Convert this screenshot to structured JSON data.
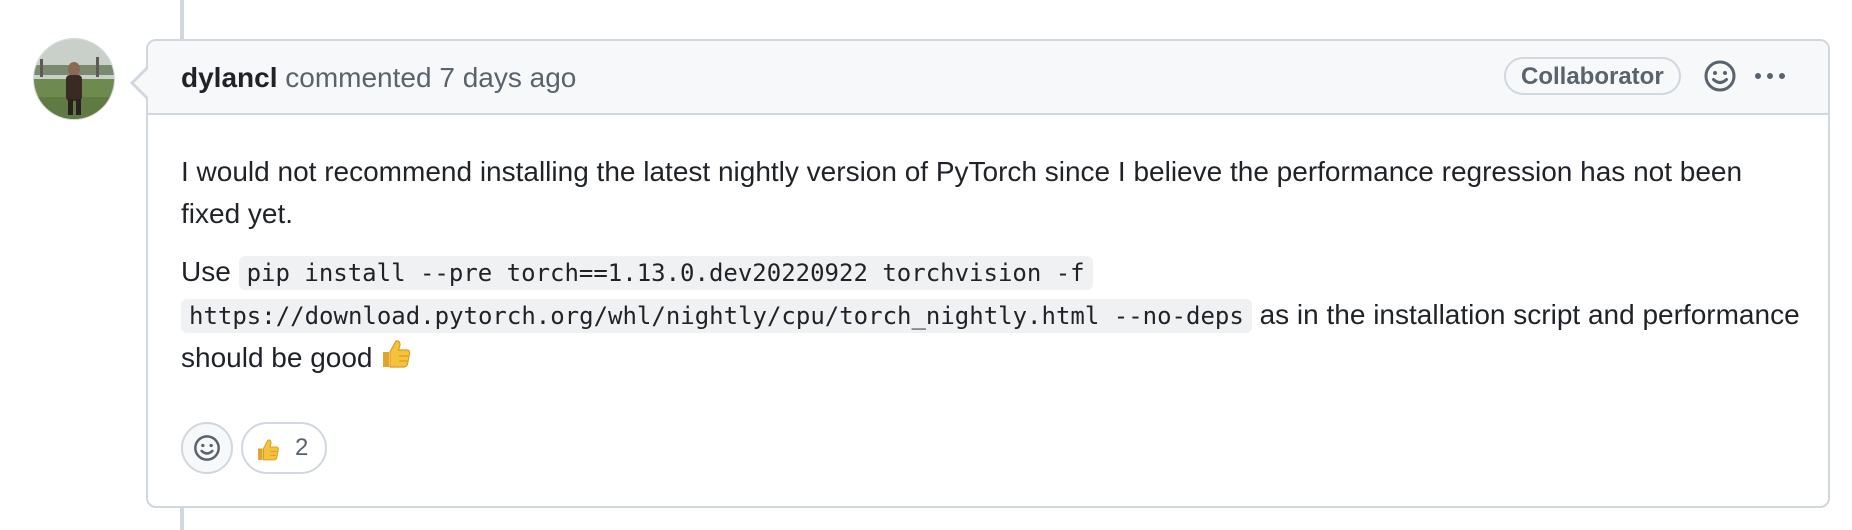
{
  "comment": {
    "author": "dylancl",
    "action": "commented",
    "time": "7 days ago",
    "role_badge": "Collaborator",
    "body": {
      "paragraph1": "I would not recommend installing the latest nightly version of PyTorch since I believe the performance regression has not been fixed yet.",
      "paragraph2_prefix": "Use",
      "code_line1": "pip install --pre torch==1.13.0.dev20220922 torchvision -f",
      "code_line2": "https://download.pytorch.org/whl/nightly/cpu/torch_nightly.html --no-deps",
      "paragraph2_suffix": "as in the installation script and performance should be good"
    },
    "reactions": [
      {
        "emoji": "thumbs-up-icon",
        "count": "2"
      }
    ]
  },
  "icons": {
    "avatar": "avatar-photo",
    "header_emoji": "smiley-icon",
    "header_more": "kebab-horizontal-icon",
    "add_reaction": "smiley-icon",
    "inline_emoji": "thumbs-up-icon"
  },
  "colors": {
    "border": "#d0d7de",
    "header_bg": "#f6f8fa",
    "muted_text": "#59636e",
    "text": "#1f2328",
    "code_bg": "#eff1f3",
    "thumb_yellow": "#f5c33b"
  }
}
